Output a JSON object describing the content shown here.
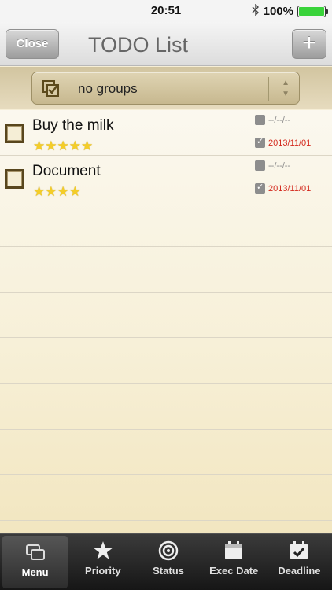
{
  "status": {
    "time": "20:51",
    "battery": "100%",
    "bluetooth_icon": "bluetooth-icon"
  },
  "nav": {
    "close_label": "Close",
    "title": "TODO List",
    "add_label": "+"
  },
  "group": {
    "selected": "no groups",
    "icon": "group-check-icon"
  },
  "todos": [
    {
      "title": "Buy the milk",
      "stars": "★★★★★",
      "exec_date": "--/--/--",
      "deadline": "2013/11/01"
    },
    {
      "title": "Document",
      "stars": "★★★★",
      "exec_date": "--/--/--",
      "deadline": "2013/11/01"
    }
  ],
  "tabs": [
    {
      "label": "Menu",
      "icon": "menu-icon"
    },
    {
      "label": "Priority",
      "icon": "star-icon"
    },
    {
      "label": "Status",
      "icon": "target-icon"
    },
    {
      "label": "Exec Date",
      "icon": "calendar-icon"
    },
    {
      "label": "Deadline",
      "icon": "calendar-check-icon"
    }
  ],
  "colors": {
    "deadline": "#d42a1e",
    "star": "#f4cd28",
    "battery": "#39d33a"
  }
}
